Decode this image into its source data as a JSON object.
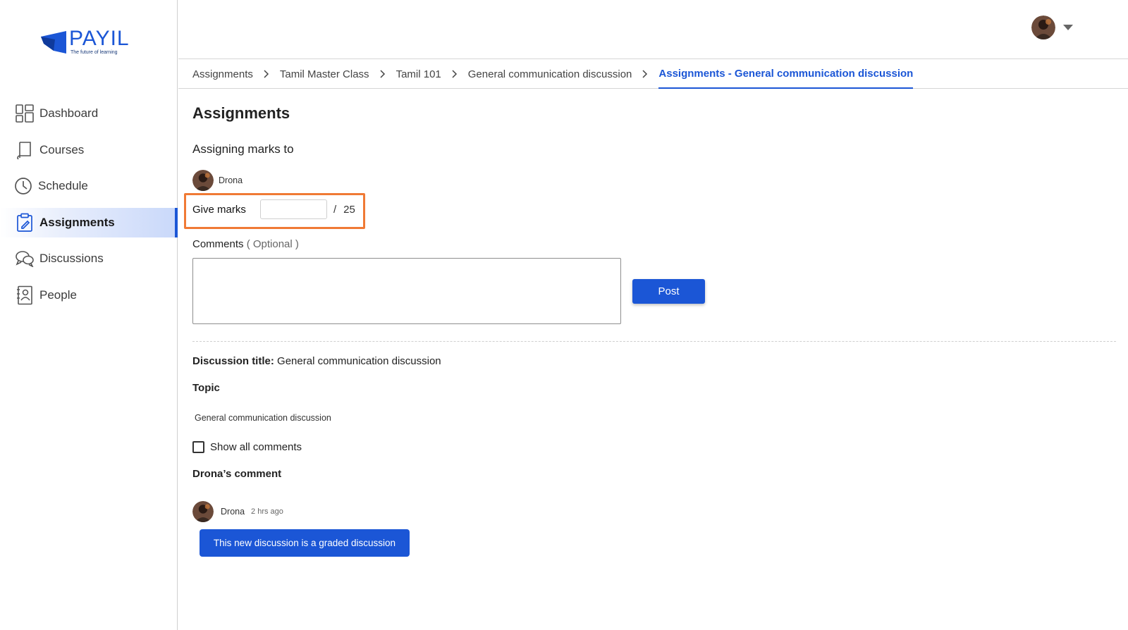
{
  "brand": {
    "name": "PAYIL",
    "tagline": "The future of learning",
    "accent": "#1b56d6"
  },
  "sidebar": {
    "items": [
      {
        "label": "Dashboard",
        "icon": "dashboard-icon"
      },
      {
        "label": "Courses",
        "icon": "book-icon"
      },
      {
        "label": "Schedule",
        "icon": "clock-icon"
      },
      {
        "label": "Assignments",
        "icon": "clipboard-icon",
        "active": true
      },
      {
        "label": "Discussions",
        "icon": "chat-bubbles-icon"
      },
      {
        "label": "People",
        "icon": "contact-book-icon"
      }
    ]
  },
  "breadcrumb": {
    "items": [
      "Assignments",
      "Tamil Master Class",
      "Tamil 101",
      "General communication discussion",
      "Assignments - General communication discussion"
    ]
  },
  "main": {
    "title": "Assignments",
    "subtitle": "Assigning marks to",
    "student_name": "Drona",
    "marks": {
      "label": "Give marks",
      "value": "",
      "slash": "/",
      "total": "25"
    },
    "comments": {
      "label": "Comments",
      "optional": "( Optional )",
      "value": ""
    },
    "post_label": "Post",
    "discussion": {
      "title_label": "Discussion title:",
      "title_value": "General communication discussion",
      "topic_label": "Topic",
      "topic_text": "General communication discussion"
    },
    "show_all_label": "Show all comments",
    "show_all_checked": false,
    "user_comment_label": "Drona’s comment",
    "comment": {
      "author": "Drona",
      "time": "2 hrs ago",
      "text": "This new discussion is a graded discussion"
    }
  },
  "colors": {
    "highlight_box": "#f07a35",
    "primary_button": "#1b56d6"
  }
}
